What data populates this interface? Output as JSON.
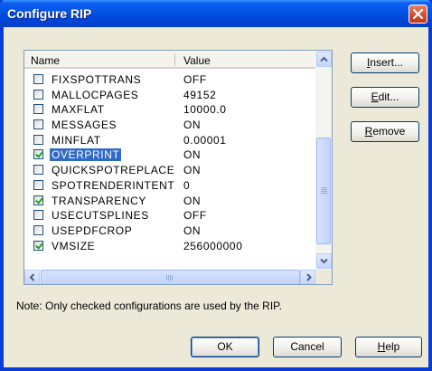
{
  "window": {
    "title": "Configure RIP"
  },
  "list": {
    "columns": {
      "name": "Name",
      "value": "Value"
    },
    "rows": [
      {
        "name": "FIXSPOTTRANS",
        "value": "OFF",
        "checked": false,
        "selected": false
      },
      {
        "name": "MALLOCPAGES",
        "value": "49152",
        "checked": false,
        "selected": false
      },
      {
        "name": "MAXFLAT",
        "value": "10000.0",
        "checked": false,
        "selected": false
      },
      {
        "name": "MESSAGES",
        "value": "ON",
        "checked": false,
        "selected": false
      },
      {
        "name": "MINFLAT",
        "value": "0.00001",
        "checked": false,
        "selected": false
      },
      {
        "name": "OVERPRINT",
        "value": "ON",
        "checked": true,
        "selected": true
      },
      {
        "name": "QUICKSPOTREPLACE",
        "value": "ON",
        "checked": false,
        "selected": false
      },
      {
        "name": "SPOTRENDERINTENT",
        "value": "0",
        "checked": false,
        "selected": false
      },
      {
        "name": "TRANSPARENCY",
        "value": "ON",
        "checked": true,
        "selected": false
      },
      {
        "name": "USECUTSPLINES",
        "value": "OFF",
        "checked": false,
        "selected": false
      },
      {
        "name": "USEPDFCROP",
        "value": "ON",
        "checked": false,
        "selected": false
      },
      {
        "name": "VMSIZE",
        "value": "256000000",
        "checked": true,
        "selected": false
      }
    ]
  },
  "buttons": {
    "insert": {
      "mnemonic": "I",
      "rest": "nsert..."
    },
    "edit": {
      "mnemonic": "E",
      "rest": "dit..."
    },
    "remove": {
      "mnemonic": "R",
      "rest": "emove"
    },
    "ok": "OK",
    "cancel": "Cancel",
    "help": {
      "mnemonic": "H",
      "rest": "elp"
    }
  },
  "note": "Note: Only checked configurations are used by the RIP.",
  "colors": {
    "titlebar": "#0a5cf0",
    "selection": "#316ac5",
    "dialog_bg": "#ece9d8"
  }
}
